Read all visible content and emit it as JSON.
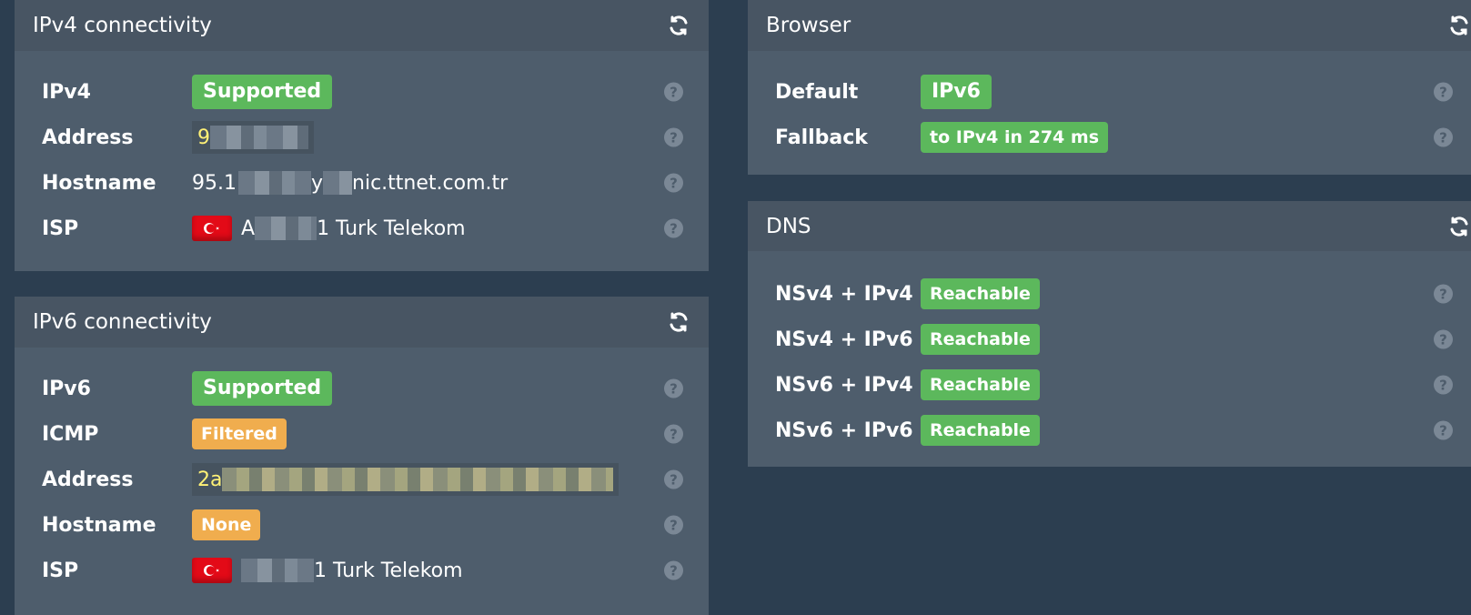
{
  "ipv4": {
    "title": "IPv4 connectivity",
    "rows": {
      "ipv4": {
        "label": "IPv4",
        "status": "Supported"
      },
      "address": {
        "label": "Address",
        "value_prefix": "9"
      },
      "hostname": {
        "label": "Hostname",
        "value_prefix": "95.1",
        "value_mid": "y",
        "value_suffix": "nic.ttnet.com.tr"
      },
      "isp": {
        "label": "ISP",
        "value_prefix": "A",
        "value_suffix": "1 Turk Telekom"
      }
    }
  },
  "ipv6": {
    "title": "IPv6 connectivity",
    "rows": {
      "ipv6": {
        "label": "IPv6",
        "status": "Supported"
      },
      "icmp": {
        "label": "ICMP",
        "status": "Filtered"
      },
      "address": {
        "label": "Address",
        "value_prefix": "2a"
      },
      "hostname": {
        "label": "Hostname",
        "status": "None"
      },
      "isp": {
        "label": "ISP",
        "value_suffix": "1 Turk Telekom"
      }
    }
  },
  "browser": {
    "title": "Browser",
    "rows": {
      "default": {
        "label": "Default",
        "status": "IPv6"
      },
      "fallback": {
        "label": "Fallback",
        "status": "to IPv4 in 274 ms"
      }
    }
  },
  "dns": {
    "title": "DNS",
    "rows": [
      {
        "label": "NSv4 + IPv4",
        "status": "Reachable"
      },
      {
        "label": "NSv4 + IPv6",
        "status": "Reachable"
      },
      {
        "label": "NSv6 + IPv4",
        "status": "Reachable"
      },
      {
        "label": "NSv6 + IPv6",
        "status": "Reachable"
      }
    ]
  },
  "help_glyph": "?",
  "colors": {
    "background": "#2c3e50",
    "panel": "#4e5d6c",
    "success": "#5cb85c",
    "warning": "#f0ad4e"
  },
  "icons": {
    "refresh": "refresh-icon",
    "help": "help-icon",
    "flag": "turkey-flag-icon"
  }
}
